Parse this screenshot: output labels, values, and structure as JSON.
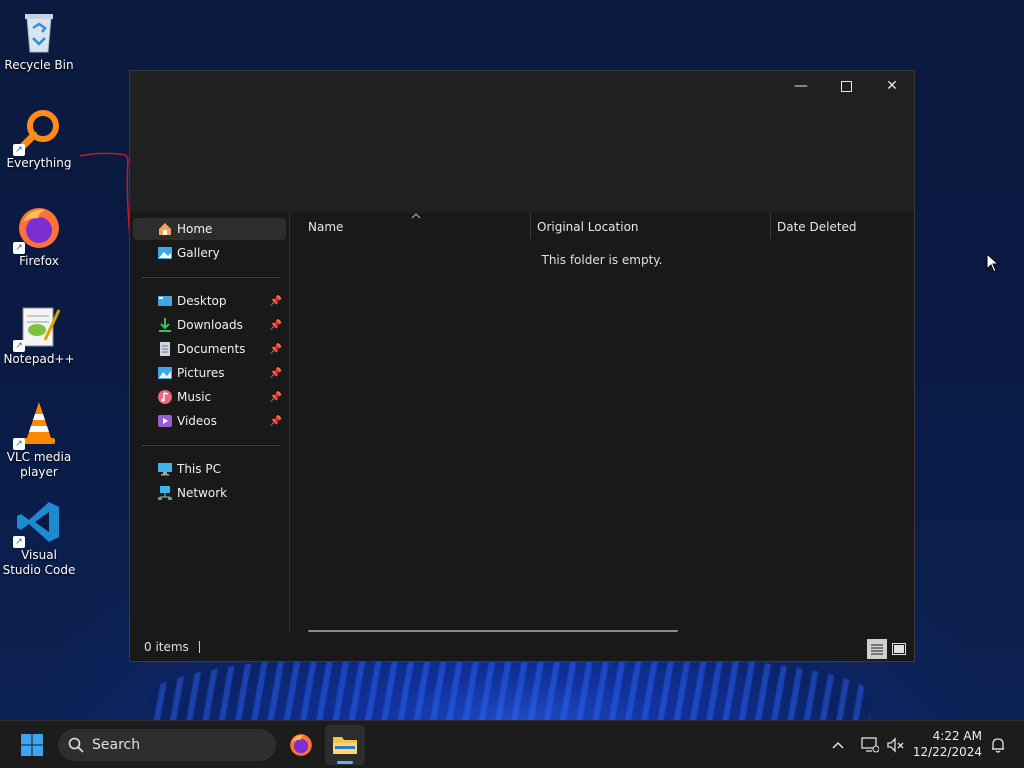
{
  "desktop": {
    "icons": [
      {
        "label": "Recycle Bin",
        "icon": "recycle-bin-icon"
      },
      {
        "label": "Everything",
        "icon": "everything-search-icon"
      },
      {
        "label": "Firefox",
        "icon": "firefox-icon"
      },
      {
        "label": "Notepad++",
        "icon": "notepad-plus-plus-icon"
      },
      {
        "label": "VLC media player",
        "icon": "vlc-cone-icon"
      },
      {
        "label": "Visual Studio Code",
        "icon": "vscode-icon"
      }
    ]
  },
  "window": {
    "controls": {
      "minimize": "—",
      "maximize": "☐",
      "close": "✕"
    },
    "sidebar": {
      "group1": [
        {
          "label": "Home",
          "icon": "home-icon",
          "active": true
        },
        {
          "label": "Gallery",
          "icon": "gallery-icon"
        }
      ],
      "group2": [
        {
          "label": "Desktop",
          "icon": "desktop-folder-icon",
          "pinned": true
        },
        {
          "label": "Downloads",
          "icon": "downloads-icon",
          "pinned": true
        },
        {
          "label": "Documents",
          "icon": "documents-icon",
          "pinned": true
        },
        {
          "label": "Pictures",
          "icon": "pictures-icon",
          "pinned": true
        },
        {
          "label": "Music",
          "icon": "music-icon",
          "pinned": true
        },
        {
          "label": "Videos",
          "icon": "videos-icon",
          "pinned": true
        }
      ],
      "group3": [
        {
          "label": "This PC",
          "icon": "this-pc-icon"
        },
        {
          "label": "Network",
          "icon": "network-icon"
        }
      ]
    },
    "columns": [
      "Name",
      "Original Location",
      "Date Deleted"
    ],
    "empty_message": "This folder is empty.",
    "status": {
      "item_count": "0 items"
    }
  },
  "taskbar": {
    "search_label": "Search",
    "clock": {
      "time": "4:22 AM",
      "date": "12/22/2024"
    }
  },
  "colors": {
    "window_bg": "#191919",
    "titlebar_bg": "#202020",
    "taskbar_bg": "#1c1c1c",
    "accent": "#0078d4"
  }
}
